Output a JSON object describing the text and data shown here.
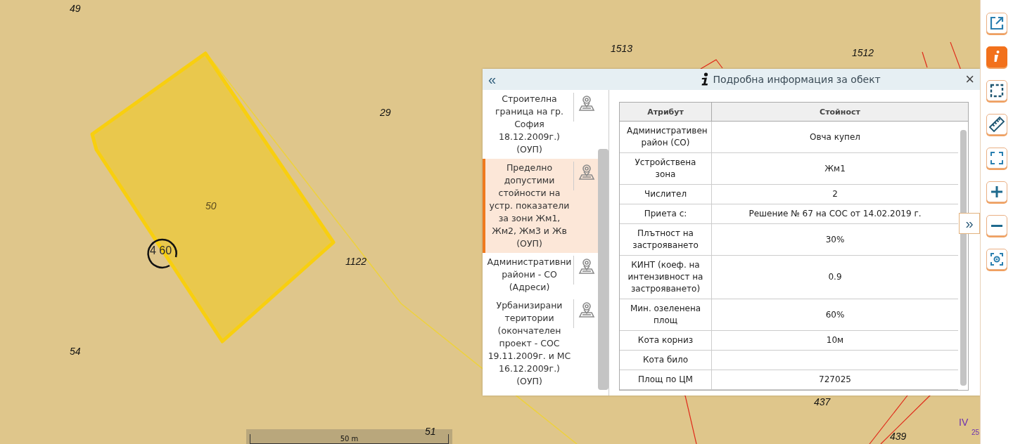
{
  "map": {
    "labels": [
      {
        "text": "49",
        "kind": "parcel"
      },
      {
        "text": "1513",
        "kind": "parcel"
      },
      {
        "text": "1512",
        "kind": "parcel"
      },
      {
        "text": "29",
        "kind": "parcel"
      },
      {
        "text": "50",
        "kind": "selected-parcel"
      },
      {
        "text": "4 60",
        "kind": "point"
      },
      {
        "text": "1122",
        "kind": "parcel"
      },
      {
        "text": "54",
        "kind": "parcel"
      },
      {
        "text": "51",
        "kind": "parcel"
      },
      {
        "text": "437",
        "kind": "parcel"
      },
      {
        "text": "439",
        "kind": "parcel"
      },
      {
        "text": "IV",
        "kind": "zone"
      },
      {
        "text": "25",
        "kind": "zone-index"
      }
    ],
    "scale_bar": {
      "label": "50 m"
    }
  },
  "info_panel": {
    "collapse_button": "«",
    "title": "Подробна информация за обект",
    "close_button": "×",
    "expand_button": "»",
    "layers": [
      {
        "name": "Строителна граница на гр. София 18.12.2009г.) (ОУП)",
        "selected": false
      },
      {
        "name": "Пределно допустими стойности на устр. показатели за зони Жм1, Жм2, Жм3 и Жв (ОУП)",
        "selected": true
      },
      {
        "name": "Административни райони - СО (Адреси)",
        "selected": false
      },
      {
        "name": "Урбанизирани територии (окончателен проект - СОС 19.11.2009г. и МС 16.12.2009г.) (ОУП)",
        "selected": false
      }
    ],
    "table": {
      "columns": [
        "Атрибут",
        "Стойност"
      ],
      "rows": [
        [
          "Административен район (СО)",
          "Овча купел"
        ],
        [
          "Устройствена зона",
          "Жм1"
        ],
        [
          "Числител",
          "2"
        ],
        [
          "Приета с:",
          "Решение № 67 на СОС от 14.02.2019 г."
        ],
        [
          "Плътност на застрояването",
          "30%"
        ],
        [
          "КИНТ (коеф. на интензивност на застрояването)",
          "0.9"
        ],
        [
          "Мин. озеленена площ",
          "60%"
        ],
        [
          "Кота корниз",
          "10м"
        ],
        [
          "Кота било",
          null
        ],
        [
          "Площ по ЦМ",
          "727025"
        ]
      ]
    }
  },
  "toolbar": {
    "tools": [
      {
        "kind": "open-external",
        "selected": false
      },
      {
        "kind": "info",
        "selected": true
      },
      {
        "kind": "select-area",
        "selected": false
      },
      {
        "kind": "measure",
        "selected": false
      },
      {
        "kind": "full-extent",
        "selected": false
      },
      {
        "kind": "zoom-in",
        "selected": false
      },
      {
        "kind": "zoom-out",
        "selected": false
      },
      {
        "kind": "locate",
        "selected": false
      }
    ]
  }
}
